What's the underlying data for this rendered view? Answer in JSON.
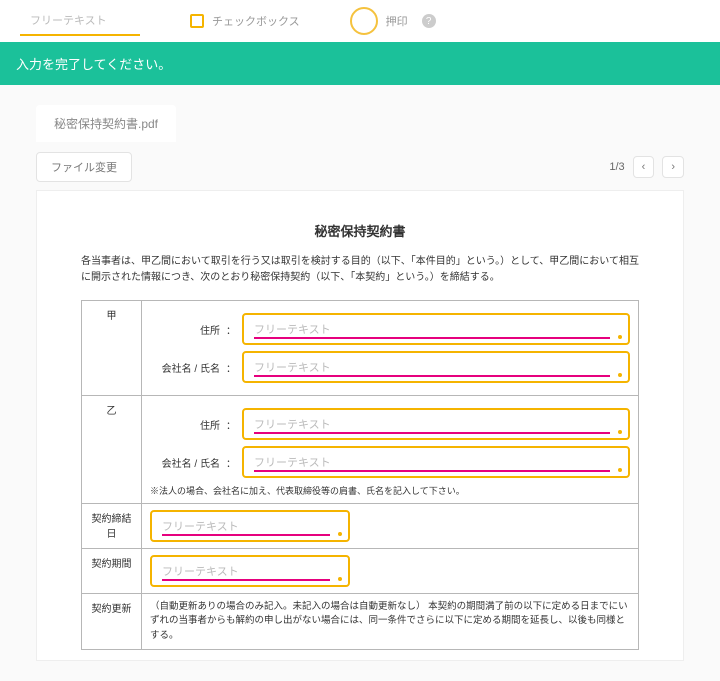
{
  "toolbar": {
    "free_text": "フリーテキスト",
    "checkbox": "チェックボックス",
    "seal": "押印"
  },
  "banner": "入力を完了してください。",
  "tab_label": "秘密保持契約書.pdf",
  "file_change": "ファイル変更",
  "page_indicator": "1/3",
  "prev": "‹",
  "next": "›",
  "doc": {
    "title": "秘密保持契約書",
    "intro": "各当事者は、甲乙間において取引を行う又は取引を検討する目的（以下、「本件目的」という。）として、甲乙間において相互に開示された情報につき、次のとおり秘密保持契約（以下、「本契約」という。）を締結する。",
    "party_a": "甲",
    "party_b": "乙",
    "address_label": "住所",
    "company_label": "会社名 / 氏名",
    "placeholder": "フリーテキスト",
    "corp_note": "※法人の場合、会社名に加え、代表取締役等の肩書、氏名を記入して下さい。",
    "date_label": "契約締結日",
    "period_label": "契約期間",
    "renew_label": "契約更新",
    "renew_text": "（自動更新ありの場合のみ記入。未記入の場合は自動更新なし）\n本契約の期間満了前の以下に定める日までにいずれの当事者からも解約の申し出がない場合には、同一条件でさらに以下に定める期間を延長し、以後も同様とする。"
  }
}
